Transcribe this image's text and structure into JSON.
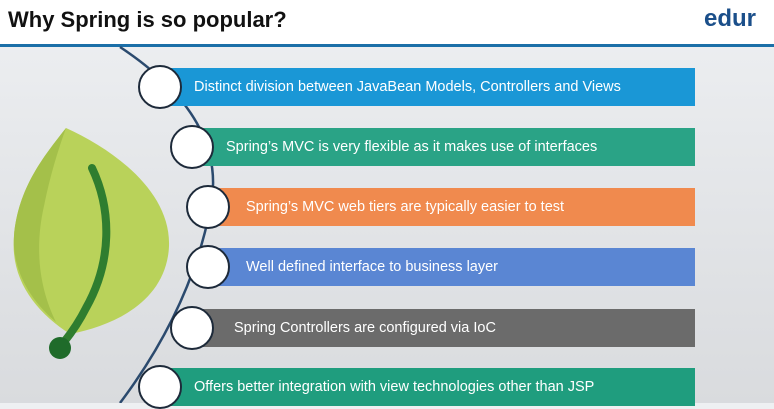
{
  "header": {
    "title": "Why Spring is so popular?",
    "brand": "edur"
  },
  "colors": {
    "blue": "#1a97d6",
    "teal": "#2aa386",
    "orange": "#f08a4e",
    "cornflower": "#5a86d3",
    "gray": "#6b6b6b",
    "green": "#1f9d7e",
    "leaf_light": "#b9d25a",
    "leaf_dark": "#2f7d2f"
  },
  "points": [
    {
      "text": "Distinct division between JavaBean Models, Controllers and Views",
      "color": "#1a97d6"
    },
    {
      "text": "Spring’s MVC is very flexible as it makes use of interfaces",
      "color": "#2aa386"
    },
    {
      "text": "Spring’s MVC web tiers are typically easier to test",
      "color": "#f08a4e"
    },
    {
      "text": "Well defined interface to business layer",
      "color": "#5a86d3"
    },
    {
      "text": "Spring Controllers are configured via IoC",
      "color": "#6b6b6b"
    },
    {
      "text": "Offers better integration with view technologies other than JSP",
      "color": "#1f9d7e"
    }
  ]
}
